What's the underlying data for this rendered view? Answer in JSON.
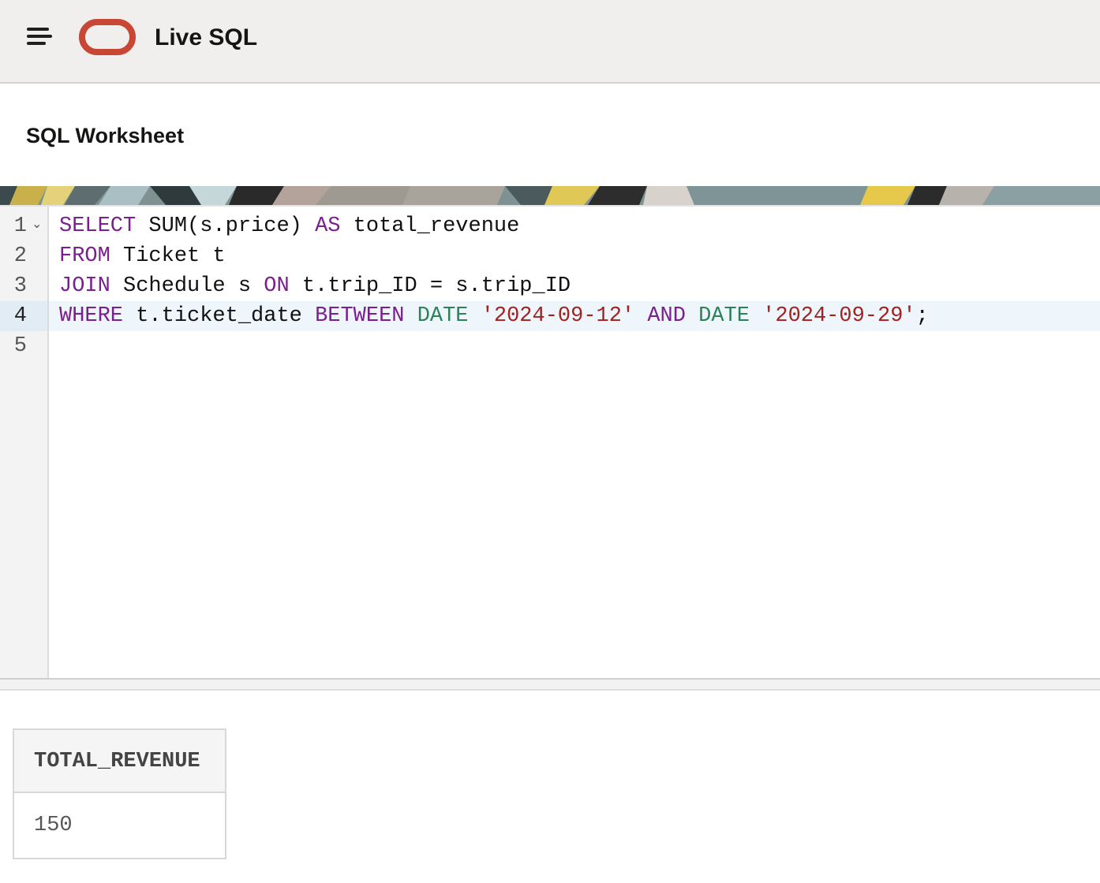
{
  "header": {
    "menu_icon": "hamburger-menu-icon",
    "logo_icon": "oracle-logo-icon",
    "app_title": "Live SQL",
    "brand_color": "#c74634"
  },
  "page": {
    "title": "SQL Worksheet"
  },
  "editor": {
    "line_numbers": [
      "1",
      "2",
      "3",
      "4",
      "5"
    ],
    "active_line": 4,
    "fold_icon": "chevron-down-icon",
    "lines": [
      [
        {
          "t": "SELECT",
          "c": "kw"
        },
        {
          "t": " SUM(s.price) ",
          "c": ""
        },
        {
          "t": "AS",
          "c": "kw"
        },
        {
          "t": " total_revenue",
          "c": ""
        }
      ],
      [
        {
          "t": "FROM",
          "c": "kw"
        },
        {
          "t": " Ticket t",
          "c": ""
        }
      ],
      [
        {
          "t": "JOIN",
          "c": "kw"
        },
        {
          "t": " Schedule s ",
          "c": ""
        },
        {
          "t": "ON",
          "c": "kw"
        },
        {
          "t": " t.trip_ID = s.trip_ID",
          "c": ""
        }
      ],
      [
        {
          "t": "WHERE",
          "c": "kw"
        },
        {
          "t": " t.ticket_date ",
          "c": ""
        },
        {
          "t": "BETWEEN",
          "c": "kw"
        },
        {
          "t": " ",
          "c": ""
        },
        {
          "t": "DATE",
          "c": "ty"
        },
        {
          "t": " ",
          "c": ""
        },
        {
          "t": "'2024-09-12'",
          "c": "str"
        },
        {
          "t": " ",
          "c": ""
        },
        {
          "t": "AND",
          "c": "kw"
        },
        {
          "t": " ",
          "c": ""
        },
        {
          "t": "DATE",
          "c": "ty"
        },
        {
          "t": " ",
          "c": ""
        },
        {
          "t": "'2024-09-29'",
          "c": "str"
        },
        {
          "t": ";",
          "c": ""
        }
      ],
      []
    ],
    "colors": {
      "keyword": "#7a1f8e",
      "type": "#2a8256",
      "string": "#a3211f"
    }
  },
  "results": {
    "columns": [
      "TOTAL_REVENUE"
    ],
    "rows": [
      [
        "150"
      ]
    ]
  }
}
